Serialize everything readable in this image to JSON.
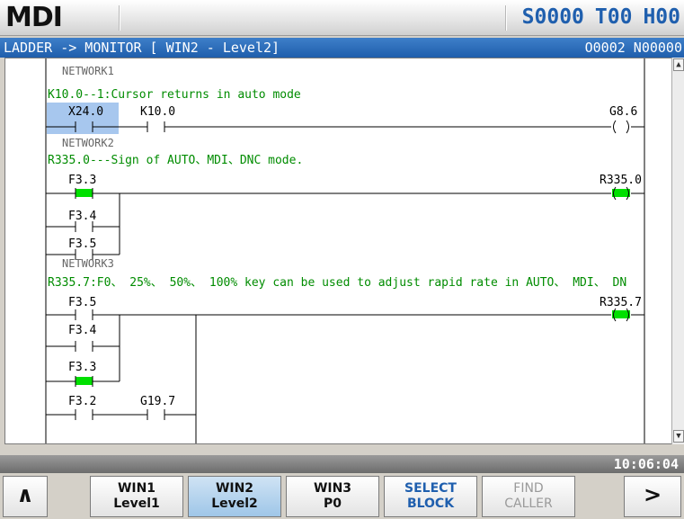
{
  "header": {
    "mode": "MDI",
    "spindle": "S0000",
    "tool": "T00",
    "h_offset": "H00"
  },
  "titlebar": {
    "title": "LADDER -> MONITOR [ WIN2 - Level2]",
    "program": "O0002 N00000"
  },
  "ladder": {
    "networks": [
      {
        "name": "NETWORK1",
        "comment": "K10.0--1:Cursor returns in auto mode",
        "contacts": [
          {
            "label": "X24.0",
            "state": "off",
            "selected": true
          },
          {
            "label": "K10.0",
            "state": "off"
          }
        ],
        "coil": {
          "label": "G8.6",
          "state": "off"
        }
      },
      {
        "name": "NETWORK2",
        "comment": "R335.0---Sign of AUTO、MDI、DNC mode.",
        "contacts": [
          {
            "label": "F3.3",
            "state": "on"
          },
          {
            "label": "F3.4",
            "state": "off"
          },
          {
            "label": "F3.5",
            "state": "off"
          }
        ],
        "coil": {
          "label": "R335.0",
          "state": "on"
        }
      },
      {
        "name": "NETWORK3",
        "comment": "R335.7:F0、 25%、 50%、 100% key can be used to adjust rapid rate in AUTO、 MDI、 DN",
        "contacts": [
          {
            "label": "F3.5",
            "state": "off"
          },
          {
            "label": "F3.4",
            "state": "off"
          },
          {
            "label": "F3.3",
            "state": "on"
          },
          {
            "label": "F3.2",
            "state": "off"
          },
          {
            "label": "G19.7",
            "state": "off"
          }
        ],
        "coil": {
          "label": "R335.7",
          "state": "on"
        }
      }
    ]
  },
  "scrollbar": {
    "up_icon": "scroll-up-arrow-icon",
    "down_icon": "scroll-down-arrow-icon"
  },
  "statusbar": {
    "time": "10:06:04"
  },
  "softkeys": [
    {
      "icon": "chevron-up-icon",
      "glyph": "∧"
    },
    {
      "line1": "WIN1",
      "line2": "Level1"
    },
    {
      "line1": "WIN2",
      "line2": "Level2",
      "selected": true
    },
    {
      "line1": "WIN3",
      "line2": "P0"
    },
    {
      "line1": "SELECT",
      "line2": "BLOCK"
    },
    {
      "line1": "FIND",
      "line2": "CALLER",
      "disabled": true
    },
    {
      "icon": "chevron-right-icon",
      "glyph": ">"
    }
  ],
  "colors": {
    "accent": "#1f5fae",
    "title_bar": "#2e6fbf",
    "contact_on": "#00e000",
    "comment": "#008c00",
    "selection": "#a7c7ee"
  }
}
